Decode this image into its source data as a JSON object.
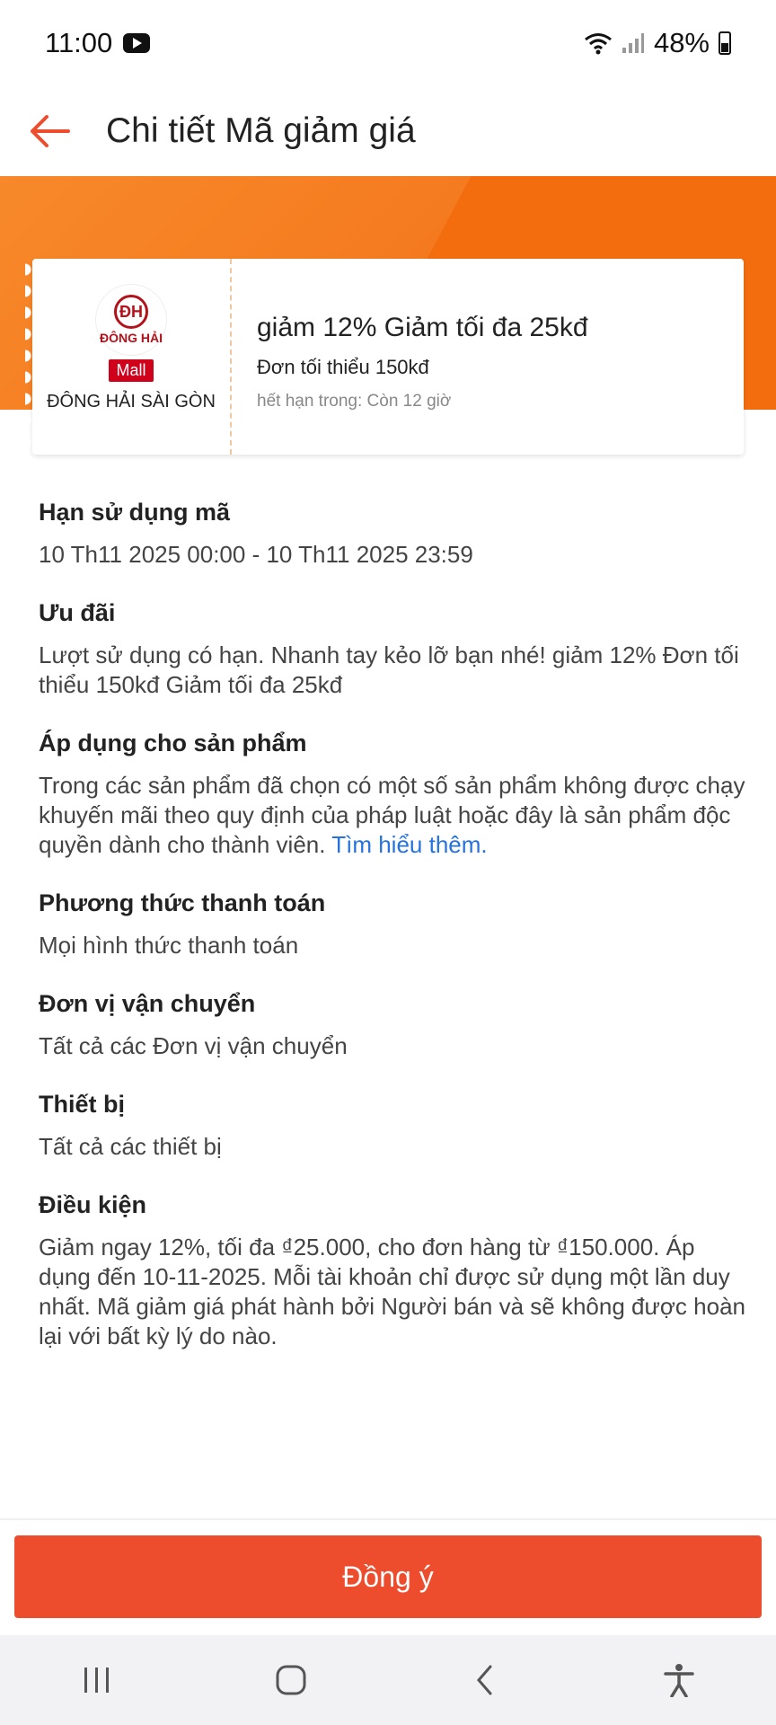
{
  "status_bar": {
    "time": "11:00",
    "battery": "48%"
  },
  "header": {
    "title": "Chi tiết Mã giảm giá"
  },
  "voucher": {
    "logo_mark": "ĐH",
    "logo_text": "ĐÔNG HẢI",
    "mall_badge": "Mall",
    "shop_name": "ĐÔNG HẢI SÀI GÒN",
    "title": "giảm 12% Giảm tối đa 25kđ",
    "min_order": "Đơn tối thiểu 150kđ",
    "expiry": "hết hạn trong: Còn 12 giờ"
  },
  "sections": {
    "validity": {
      "title": "Hạn sử dụng mã",
      "body": "10 Th11 2025 00:00 - 10 Th11 2025 23:59"
    },
    "offer": {
      "title": "Ưu đãi",
      "body": "Lượt sử dụng có hạn. Nhanh tay kẻo lỡ bạn nhé! giảm 12% Đơn tối thiểu 150kđ Giảm tối đa 25kđ"
    },
    "products": {
      "title": "Áp dụng cho sản phẩm",
      "body": "Trong các sản phẩm đã chọn có một số sản phẩm không được chạy khuyến mãi theo quy định của pháp luật hoặc đây là sản phẩm độc quyền dành cho thành viên. ",
      "link": "Tìm hiểu thêm."
    },
    "payment": {
      "title": "Phương thức thanh toán",
      "body": "Mọi hình thức thanh toán"
    },
    "shipping": {
      "title": "Đơn vị vận chuyển",
      "body": "Tất cả các Đơn vị vận chuyển"
    },
    "device": {
      "title": "Thiết bị",
      "body": "Tất cả các thiết bị"
    },
    "conditions": {
      "title": "Điều kiện",
      "body": "Giảm ngay 12%, tối đa ₫25.000, cho đơn hàng từ ₫150.000. Áp dụng đến 10-11-2025. Mỗi tài khoản chỉ được sử dụng một lần duy nhất. Mã giảm giá phát hành bởi Người bán và sẽ không được hoàn lại với bất kỳ lý do nào."
    }
  },
  "agree_button": "Đồng ý",
  "colors": {
    "accent": "#ee4d2d",
    "banner": "#f57a1f",
    "link": "#2673dd",
    "mall": "#d0011b"
  }
}
